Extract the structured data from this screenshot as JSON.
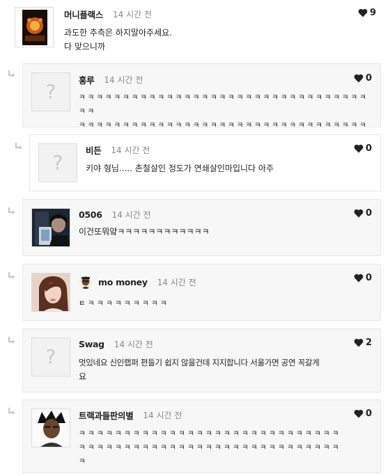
{
  "comments": [
    {
      "name": "머니플랙스",
      "time": "14 시간 전",
      "likes": "9",
      "lines": [
        "과도한 추측은 하지말아주세요.",
        "다 맞으니까"
      ]
    },
    {
      "name": "홍루",
      "time": "14 시간 전",
      "likes": "0",
      "lines": [
        "ㅋ ㅋ ㅋ ㅋ ㅋ ㅋ ㅋ ㅋ ㅋ ㅋ ㅋ ㅋ ㅋ ㅋ ㅋ ㅋ ㅋ ㅋ ㅋ ㅋ ㅋ ㅋ ㅋ ㅋ ㅋ ㅋ ㅋ ㅋ ㅋ ㅋ ㅋ ㅋ ㅋ ㅋ ㅋ",
        "ㅋ ㅋ ㅋ ㅋ ㅋ ㅋ ㅋ ㅋ ㅋ ㅋ ㅋ ㅋ ㅋ ㅋ ㅋ ㅋ ㅋ ㅋ ㅋ ㅋ ㅋ ㅋ ㅋ ㅋ ㅋ ㅋ ㅋ ㅋ ㅋ ㅋ ㅋ ㅋ ㅋ ㅋ ㅋ"
      ]
    },
    {
      "name": "비든",
      "time": "14 시간 전",
      "likes": "0",
      "lines": [
        "키야 형님..... 촌철살인 정도가 연쇄살인마입니다 아주"
      ]
    },
    {
      "name": "0506",
      "time": "14 시간 전",
      "likes": "0",
      "lines": [
        "이건또뭐얔ㅋㅋㅋㅋㅋㅋㅋㅋㅋㅋㅋㅋ"
      ]
    },
    {
      "name": "mo money",
      "time": "14 시간 전",
      "likes": "0",
      "lines": [
        "ㅌ ㅋ ㅋ ㅋ ㅋ ㅋ ㅋ ㅋ ㅋ ㅋ"
      ]
    },
    {
      "name": "Swag",
      "time": "14 시간 전",
      "likes": "2",
      "lines": [
        "멋있네요 신인랩퍼 편들기 쉽지 않을건데 지지합니다 서울가면 공연 꼭갈게",
        "요"
      ]
    },
    {
      "name": "트랙과들판의별",
      "time": "14 시간 전",
      "likes": "0",
      "lines": [
        "ㅋ ㅋ ㅋ ㅋ ㅋ ㅋ ㅋ ㅋ ㅋ ㅋ ㅋ ㅋ ㅋ ㅋ ㅋ ㅋ ㅋ ㅋ ㅋ ㅋ ㅋ ㅋ ㅋ ㅋ ㅋ ㅋ ㅋ ㅋ ㅋ",
        "ㅋ ㅋ ㅋ ㅋ ㅋ ㅋ ㅋ ㅋ ㅋ ㅋ ㅋ ㅋ ㅋ ㅋ ㅋ ㅋ ㅋ ㅋ ㅋ ㅋ ㅋ ㅋ ㅋ ㅋ ㅋ ㅋ ㅋ ㅋ ㅋ",
        "ㅋ"
      ]
    }
  ],
  "placeholder_glyph": "?",
  "icons": {
    "heart": "heart-icon",
    "reply": "reply-arrow-icon",
    "placeholder": "question-mark-placeholder"
  }
}
